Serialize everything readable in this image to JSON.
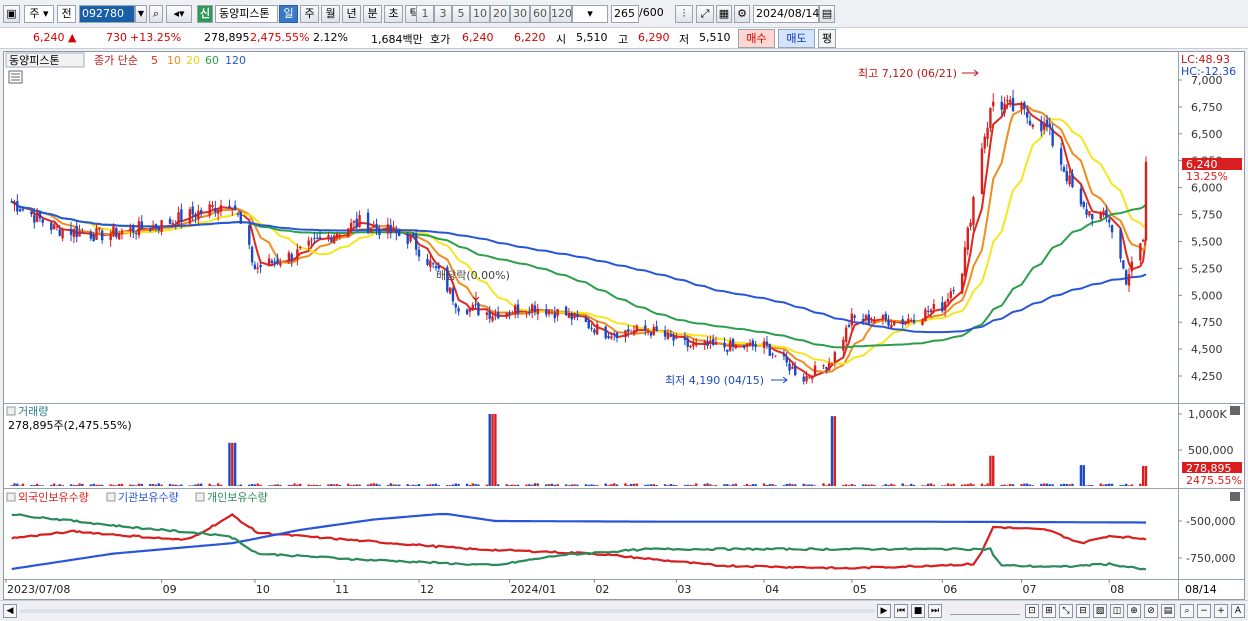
{
  "toolbar": {
    "type_select": "주",
    "market_select": "전",
    "stock_code": "092780",
    "credit_badge": "신",
    "stock_name": "동양피스톤",
    "period_tabs": [
      "일",
      "주",
      "월",
      "년",
      "분",
      "초",
      "틱"
    ],
    "active_period": "일",
    "interval_buttons": [
      "1",
      "3",
      "5",
      "10",
      "20",
      "30",
      "60",
      "120"
    ],
    "count_value": "265",
    "count_max": "/600",
    "date_value": "2024/08/14"
  },
  "quote": {
    "price": "6,240",
    "change_arrow": "▲",
    "change": "730",
    "change_pct": "+13.25%",
    "volume": "278,895",
    "volume_ratio": "2,475.55%",
    "turnover_pct": "2.12%",
    "amount": "1,684백만",
    "bid_label": "호가",
    "bid1": "6,240",
    "bid2": "6,220",
    "open_label": "시",
    "open": "5,510",
    "high_label": "고",
    "high": "6,290",
    "low_label": "저",
    "low": "5,510",
    "buy_label": "매수",
    "sell_label": "매도",
    "eval_label": "평"
  },
  "chart": {
    "legend_name": "동양피스톤",
    "legend_series_label": "종가 단순",
    "ma_periods": [
      "5",
      "10",
      "20",
      "60",
      "120"
    ],
    "ma_colors": [
      "#e0281c",
      "#f08c1e",
      "#f5e61e",
      "#2aa04a",
      "#2856d8"
    ],
    "lc_label": "LC:48.93",
    "hc_label": "HC:-12.36",
    "price_ticks": [
      "7,000",
      "6,750",
      "6,500",
      "6,250",
      "6,000",
      "5,750",
      "5,500",
      "5,250",
      "5,000",
      "4,750",
      "4,500",
      "4,250"
    ],
    "current_price_tag": "6,240",
    "current_pct_tag": "13.25%",
    "high_annotation": "최고 7,120 (06/21)",
    "low_annotation": "최저 4,190 (04/15)",
    "dividend_annotation": "배당락(0.00%)",
    "volume_title": "거래량",
    "volume_readout": "278,895주(2,475.55%)",
    "volume_ticks": [
      "1,000K",
      "500,000"
    ],
    "volume_tag": "278,895",
    "volume_pct_tag": "2475.55%",
    "holdings_legend": [
      "외국인보유수량",
      "기관보유수량",
      "개인보유수량"
    ],
    "holdings_colors": [
      "#d81e1e",
      "#2856d8",
      "#2a8a5a"
    ],
    "holdings_ticks": [
      "-500,000",
      "-750,000"
    ],
    "date_ticks": [
      "2023/07/08",
      "09",
      "10",
      "11",
      "12",
      "2024/01",
      "02",
      "03",
      "04",
      "05",
      "06",
      "07",
      "08"
    ],
    "last_date_tag": "08/14"
  },
  "chart_data": {
    "type": "candlestick",
    "price_axis": {
      "min": 4125,
      "max": 7125
    },
    "volume_axis": {
      "min": 0,
      "max": 1000000
    },
    "holdings_axis": {
      "min": -850000,
      "max": -350000
    },
    "months": [
      "2023/07",
      "2023/08",
      "2023/09",
      "2023/10",
      "2023/11",
      "2023/12",
      "2024/01",
      "2024/02",
      "2024/03",
      "2024/04",
      "2024/05",
      "2024/06",
      "2024/07",
      "2024/08"
    ],
    "close_anchors": [
      [
        "2023-07-08",
        5900
      ],
      [
        "2023-07-25",
        5620
      ],
      [
        "2023-08-10",
        5560
      ],
      [
        "2023-08-31",
        5650
      ],
      [
        "2023-09-15",
        5780
      ],
      [
        "2023-09-26",
        5880
      ],
      [
        "2023-10-04",
        5250
      ],
      [
        "2023-10-20",
        5400
      ],
      [
        "2023-11-01",
        5580
      ],
      [
        "2023-11-10",
        5680
      ],
      [
        "2023-11-28",
        5520
      ],
      [
        "2023-12-08",
        5200
      ],
      [
        "2023-12-15",
        4900
      ],
      [
        "2023-12-27",
        4830
      ],
      [
        "2024-01-10",
        4900
      ],
      [
        "2024-01-22",
        4820
      ],
      [
        "2024-02-05",
        4650
      ],
      [
        "2024-02-20",
        4680
      ],
      [
        "2024-03-05",
        4530
      ],
      [
        "2024-03-20",
        4520
      ],
      [
        "2024-04-01",
        4530
      ],
      [
        "2024-04-15",
        4230
      ],
      [
        "2024-04-25",
        4400
      ],
      [
        "2024-05-02",
        4780
      ],
      [
        "2024-05-20",
        4760
      ],
      [
        "2024-06-03",
        4900
      ],
      [
        "2024-06-10",
        5250
      ],
      [
        "2024-06-17",
        6400
      ],
      [
        "2024-06-21",
        6800
      ],
      [
        "2024-07-01",
        6700
      ],
      [
        "2024-07-10",
        6550
      ],
      [
        "2024-07-22",
        5800
      ],
      [
        "2024-08-01",
        5700
      ],
      [
        "2024-08-07",
        5150
      ],
      [
        "2024-08-13",
        5510
      ],
      [
        "2024-08-14",
        6240
      ]
    ],
    "high": {
      "value": 7120,
      "date": "2024-06-21"
    },
    "low": {
      "value": 4190,
      "date": "2024-04-15"
    },
    "last": {
      "open": 5510,
      "high": 6290,
      "low": 5510,
      "close": 6240,
      "volume": 278895
    },
    "volume_spikes": [
      {
        "date": "2023-09-26",
        "volume": 600000
      },
      {
        "date": "2023-12-27",
        "volume": 1000000
      },
      {
        "date": "2024-04-26",
        "volume": 970000
      },
      {
        "date": "2024-06-21",
        "volume": 420000
      },
      {
        "date": "2024-07-22",
        "volume": 290000
      },
      {
        "date": "2024-08-14",
        "volume": 278895
      }
    ],
    "series": [
      {
        "name": "외국인보유수량",
        "anchors": [
          [
            "2023-07-08",
            -620000
          ],
          [
            "2023-08-01",
            -570000
          ],
          [
            "2023-09-10",
            -630000
          ],
          [
            "2023-09-26",
            -460000
          ],
          [
            "2023-10-05",
            -580000
          ],
          [
            "2023-11-15",
            -640000
          ],
          [
            "2023-12-20",
            -690000
          ],
          [
            "2024-02-01",
            -720000
          ],
          [
            "2024-03-15",
            -800000
          ],
          [
            "2024-05-01",
            -820000
          ],
          [
            "2024-06-15",
            -790000
          ],
          [
            "2024-06-21",
            -540000
          ],
          [
            "2024-07-10",
            -560000
          ],
          [
            "2024-07-22",
            -650000
          ],
          [
            "2024-08-01",
            -600000
          ],
          [
            "2024-08-14",
            -620000
          ]
        ]
      },
      {
        "name": "기관보유수량",
        "anchors": [
          [
            "2023-07-08",
            -830000
          ],
          [
            "2023-08-15",
            -720000
          ],
          [
            "2023-09-26",
            -650000
          ],
          [
            "2023-10-20",
            -560000
          ],
          [
            "2023-11-15",
            -490000
          ],
          [
            "2023-12-10",
            -450000
          ],
          [
            "2023-12-28",
            -500000
          ],
          [
            "2024-03-01",
            -505000
          ],
          [
            "2024-06-01",
            -505000
          ],
          [
            "2024-08-14",
            -510000
          ]
        ]
      },
      {
        "name": "개인보유수량",
        "anchors": [
          [
            "2023-07-08",
            -450000
          ],
          [
            "2023-08-20",
            -540000
          ],
          [
            "2023-09-25",
            -600000
          ],
          [
            "2023-10-05",
            -720000
          ],
          [
            "2023-11-10",
            -760000
          ],
          [
            "2023-12-28",
            -800000
          ],
          [
            "2024-01-20",
            -730000
          ],
          [
            "2024-02-20",
            -690000
          ],
          [
            "2024-05-01",
            -690000
          ],
          [
            "2024-06-20",
            -690000
          ],
          [
            "2024-06-23",
            -800000
          ],
          [
            "2024-07-15",
            -810000
          ],
          [
            "2024-08-01",
            -790000
          ],
          [
            "2024-08-14",
            -830000
          ]
        ]
      }
    ]
  }
}
